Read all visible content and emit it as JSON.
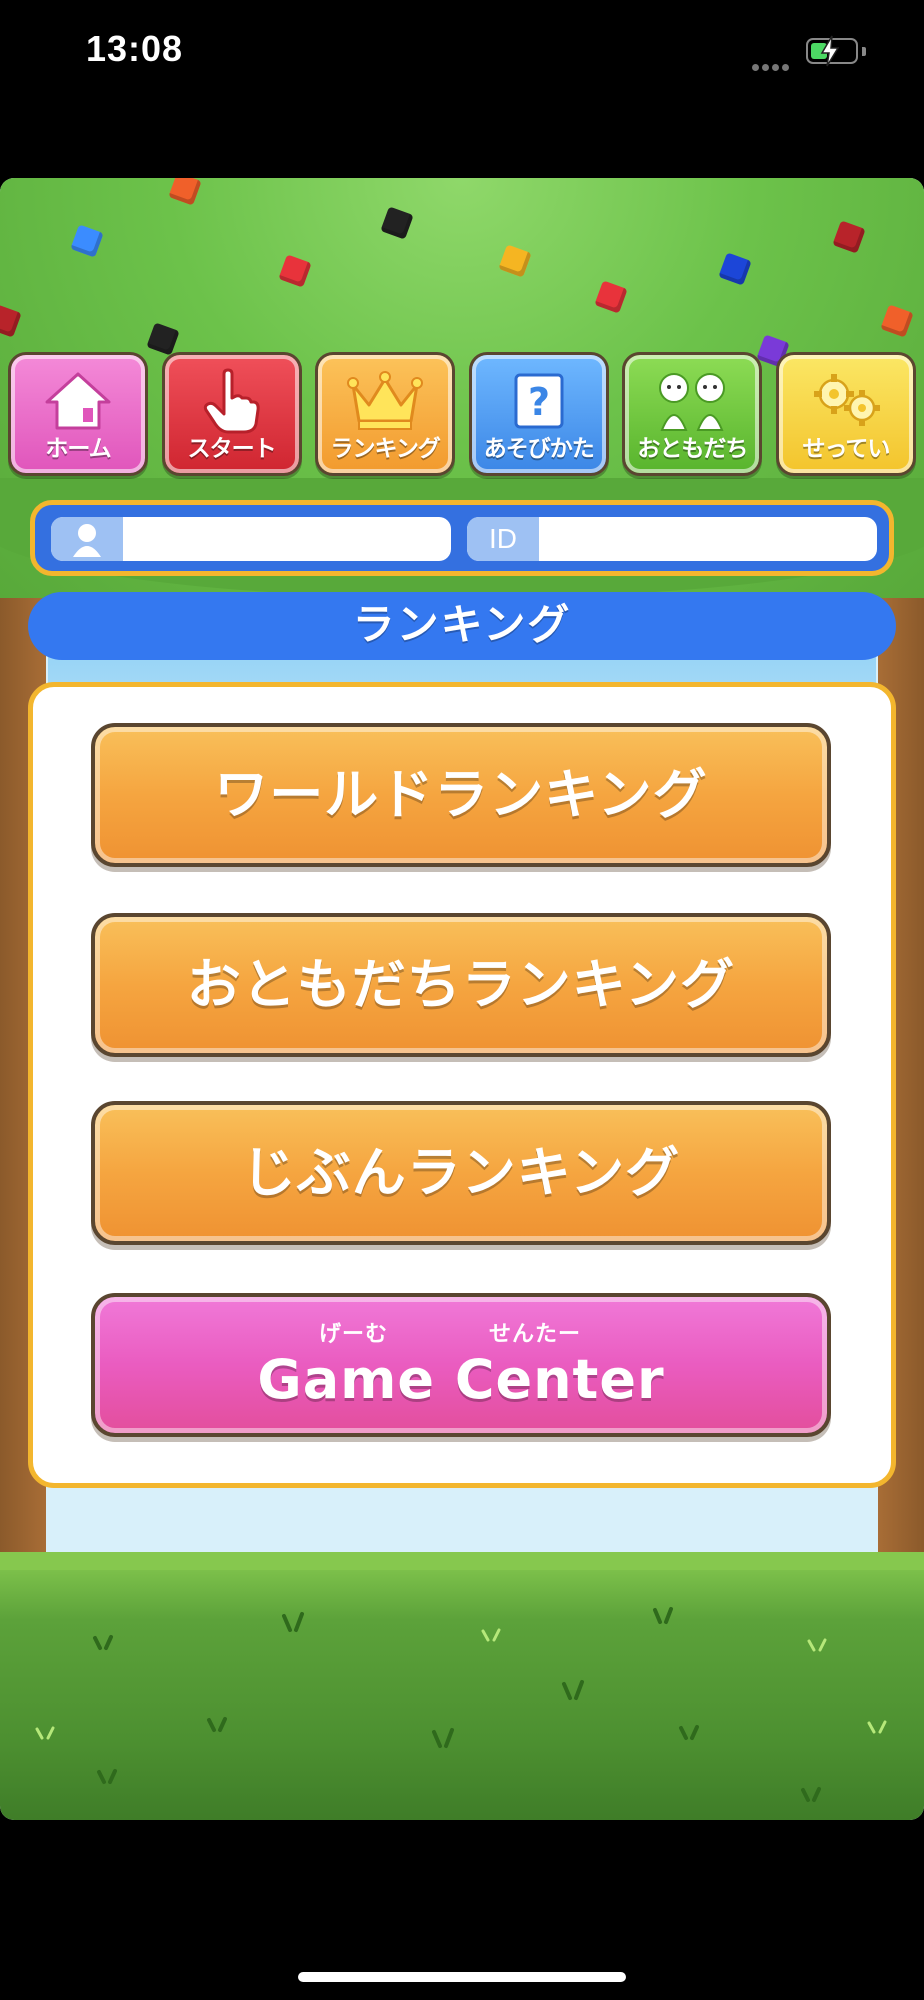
{
  "status_bar": {
    "time": "13:08"
  },
  "nav": {
    "home": "ホーム",
    "start": "スタート",
    "ranking": "ランキング",
    "howto": "あそびかた",
    "friends": "おともだち",
    "settings": "せってい"
  },
  "profile": {
    "id_tag": "ID",
    "username": "",
    "user_id": ""
  },
  "section_title": "ランキング",
  "menu": {
    "world_ranking": "ワールドランキング",
    "friends_ranking": "おともだちランキング",
    "my_ranking": "じぶんランキング",
    "game_center_ruby_1": "げーむ",
    "game_center_ruby_2": "せんたー",
    "game_center": "Game Center"
  },
  "colors": {
    "accent_blue": "#3478f0",
    "frame_yellow": "#f3b62e",
    "button_orange": "#f5a540",
    "button_pink": "#ea5cc0"
  }
}
